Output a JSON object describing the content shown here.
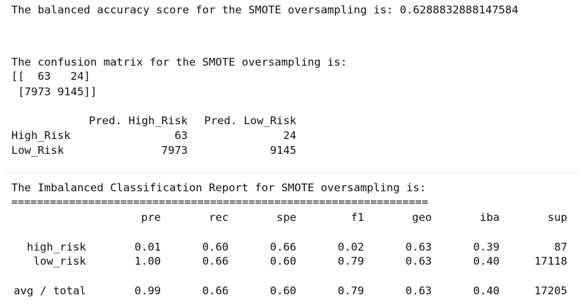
{
  "output": {
    "balanced_accuracy_line": "The balanced accuracy score for the SMOTE oversampling is: 0.6288832888147584",
    "confusion_title": "The confusion matrix for the SMOTE oversampling is:",
    "confusion_row1": "[[  63   24]",
    "confusion_row2": " [7973 9145]]",
    "dataframe": {
      "columns": [
        "Pred. High_Risk",
        "Pred. Low_Risk"
      ],
      "rows": [
        {
          "index": "High_Risk",
          "values": [
            "63",
            "24"
          ]
        },
        {
          "index": "Low_Risk",
          "values": [
            "7973",
            "9145"
          ]
        }
      ]
    },
    "report_title": "The Imbalanced Classification Report for SMOTE oversampling is:",
    "report_separator": "=================================================================",
    "report": {
      "headers": [
        "pre",
        "rec",
        "spe",
        "f1",
        "geo",
        "iba",
        "sup"
      ],
      "rows": [
        {
          "label": "high_risk",
          "values": [
            "0.01",
            "0.60",
            "0.66",
            "0.02",
            "0.63",
            "0.39",
            "87"
          ]
        },
        {
          "label": "low_risk",
          "values": [
            "1.00",
            "0.66",
            "0.60",
            "0.79",
            "0.63",
            "0.40",
            "17118"
          ]
        }
      ],
      "total": {
        "label": "avg / total",
        "values": [
          "0.99",
          "0.66",
          "0.60",
          "0.79",
          "0.63",
          "0.40",
          "17205"
        ]
      }
    }
  }
}
